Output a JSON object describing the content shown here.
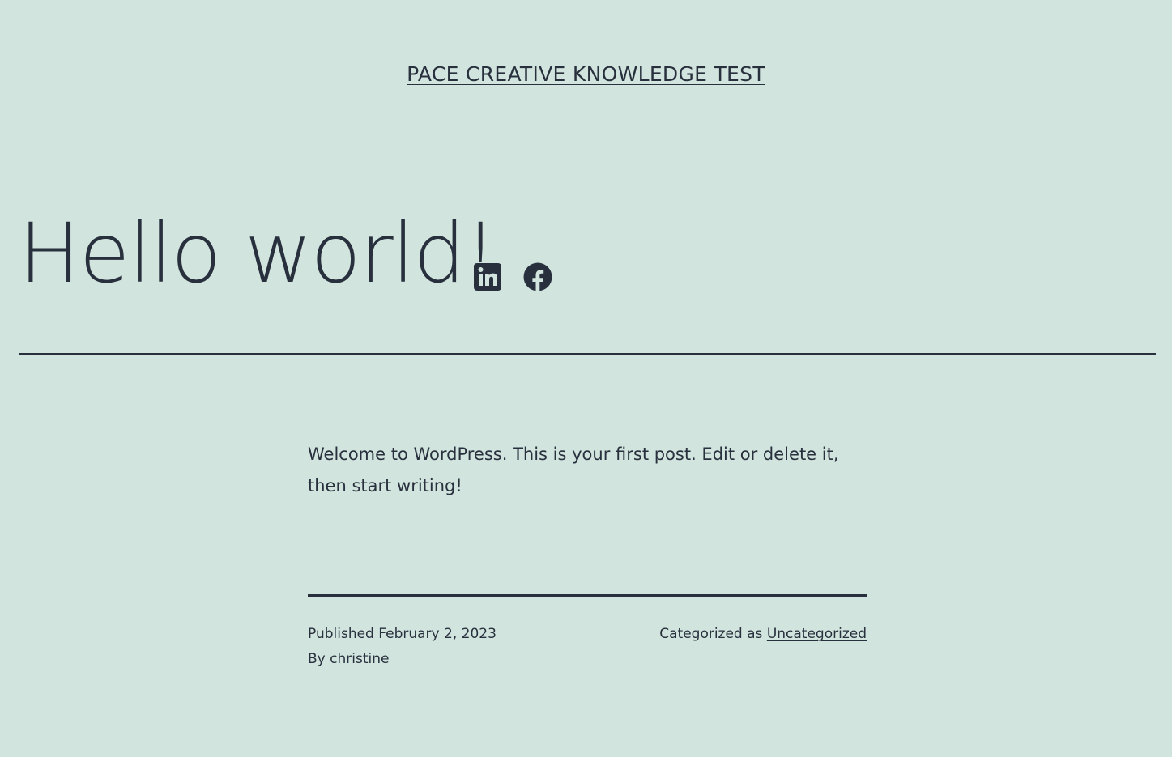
{
  "site": {
    "title": "PACE CREATIVE KNOWLEDGE TEST"
  },
  "post": {
    "title": "Hello world!",
    "share": [
      {
        "icon": "linkedin-icon",
        "label": "LinkedIn"
      },
      {
        "icon": "facebook-icon",
        "label": "Facebook"
      }
    ],
    "body": "Welcome to WordPress. This is your first post. Edit or delete it, then start writing!"
  },
  "meta": {
    "published_prefix": "Published",
    "published_date": "February 2, 2023",
    "by_prefix": "By",
    "author": "christine",
    "categorized_prefix": "Categorized as",
    "category": "Uncategorized"
  },
  "colors": {
    "background": "#d1e4dd",
    "text": "#28303d"
  }
}
